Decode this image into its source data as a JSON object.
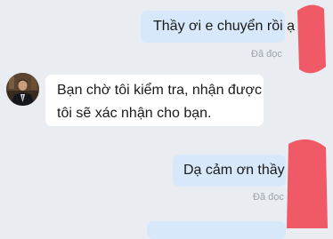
{
  "messages": [
    {
      "direction": "sent",
      "text": "Thầy ơi e chuyển rồi ạ",
      "status": "Đã đọc"
    },
    {
      "direction": "received",
      "lines": [
        "Bạn chờ tôi kiểm tra, nhận được",
        "tôi sẽ xác nhận cho bạn."
      ]
    },
    {
      "direction": "sent",
      "text": "Dạ cảm ơn thầy",
      "status": "Đã đọc"
    },
    {
      "direction": "sent",
      "text": ""
    }
  ],
  "colors": {
    "background": "#e9edf1",
    "sent_bubble": "#d7e8fa",
    "received_bubble": "#ffffff",
    "status_text": "#9aa3ad",
    "redaction": "#ef5a66"
  }
}
